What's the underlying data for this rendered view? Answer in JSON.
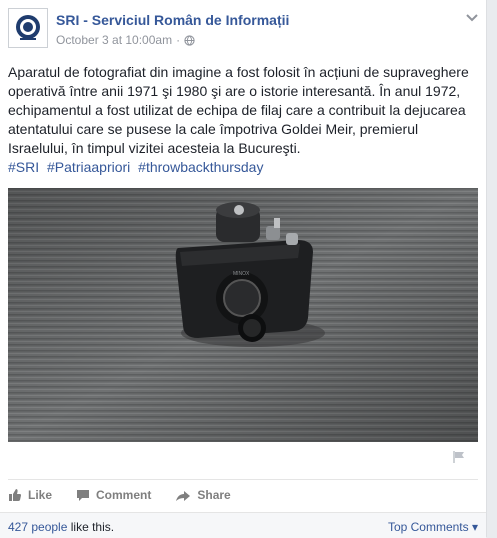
{
  "page": {
    "name": "SRI - Serviciul Român de Informații",
    "date": "October 3 at 10:00am",
    "separator": "·"
  },
  "post": {
    "text": "Aparatul de fotografiat din imagine a fost folosit în acțiuni de supraveghere operativă între anii 1971 şi 1980 şi are o istorie interesantă. În anul 1972, echipamentul a fost utilizat de echipa de filaj care a contribuit la dejucarea atentatului care se pusese la cale împotriva Goldei Meir, premierul Israelului, în timpul vizitei acesteia la Bucureşti.",
    "hashtags": [
      "#SRI",
      "#Patriaapriori",
      "#throwbackthursday"
    ]
  },
  "actions": {
    "like": "Like",
    "comment": "Comment",
    "share": "Share"
  },
  "footer": {
    "likes_count": "427 people",
    "likes_suffix": "like this.",
    "top_comments": "Top Comments ▾"
  },
  "icons": {
    "avatar": "sri-emblem-icon",
    "globe": "globe-icon",
    "chevron": "chevron-down-icon",
    "flag": "flag-icon"
  }
}
